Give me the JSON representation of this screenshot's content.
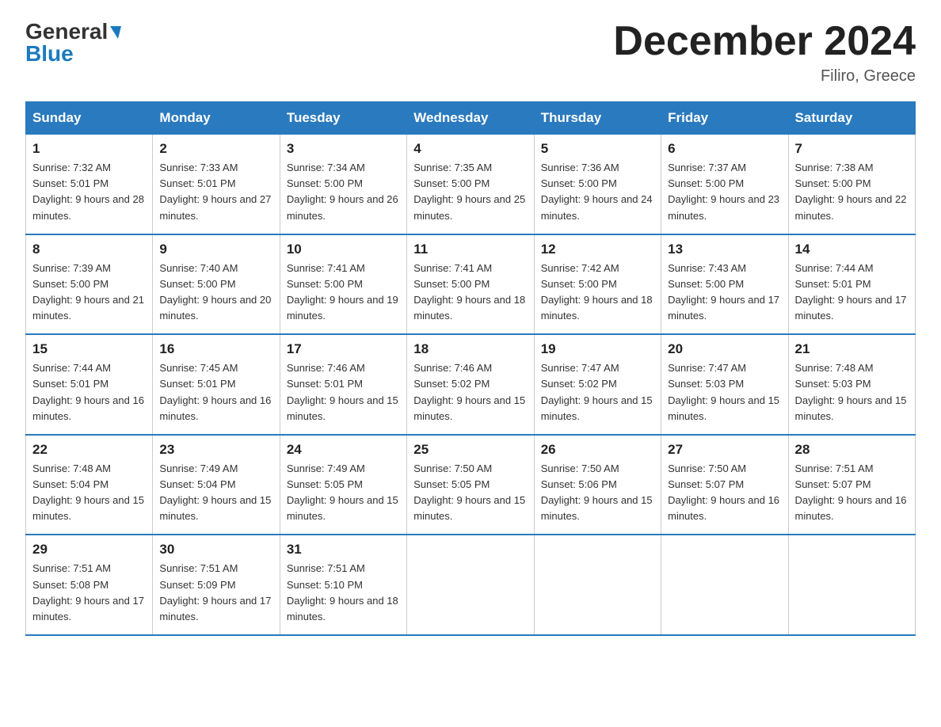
{
  "header": {
    "logo_general": "General",
    "logo_blue": "Blue",
    "title": "December 2024",
    "location": "Filiro, Greece"
  },
  "days_of_week": [
    "Sunday",
    "Monday",
    "Tuesday",
    "Wednesday",
    "Thursday",
    "Friday",
    "Saturday"
  ],
  "weeks": [
    [
      {
        "day": "1",
        "sunrise": "7:32 AM",
        "sunset": "5:01 PM",
        "daylight": "9 hours and 28 minutes."
      },
      {
        "day": "2",
        "sunrise": "7:33 AM",
        "sunset": "5:01 PM",
        "daylight": "9 hours and 27 minutes."
      },
      {
        "day": "3",
        "sunrise": "7:34 AM",
        "sunset": "5:00 PM",
        "daylight": "9 hours and 26 minutes."
      },
      {
        "day": "4",
        "sunrise": "7:35 AM",
        "sunset": "5:00 PM",
        "daylight": "9 hours and 25 minutes."
      },
      {
        "day": "5",
        "sunrise": "7:36 AM",
        "sunset": "5:00 PM",
        "daylight": "9 hours and 24 minutes."
      },
      {
        "day": "6",
        "sunrise": "7:37 AM",
        "sunset": "5:00 PM",
        "daylight": "9 hours and 23 minutes."
      },
      {
        "day": "7",
        "sunrise": "7:38 AM",
        "sunset": "5:00 PM",
        "daylight": "9 hours and 22 minutes."
      }
    ],
    [
      {
        "day": "8",
        "sunrise": "7:39 AM",
        "sunset": "5:00 PM",
        "daylight": "9 hours and 21 minutes."
      },
      {
        "day": "9",
        "sunrise": "7:40 AM",
        "sunset": "5:00 PM",
        "daylight": "9 hours and 20 minutes."
      },
      {
        "day": "10",
        "sunrise": "7:41 AM",
        "sunset": "5:00 PM",
        "daylight": "9 hours and 19 minutes."
      },
      {
        "day": "11",
        "sunrise": "7:41 AM",
        "sunset": "5:00 PM",
        "daylight": "9 hours and 18 minutes."
      },
      {
        "day": "12",
        "sunrise": "7:42 AM",
        "sunset": "5:00 PM",
        "daylight": "9 hours and 18 minutes."
      },
      {
        "day": "13",
        "sunrise": "7:43 AM",
        "sunset": "5:00 PM",
        "daylight": "9 hours and 17 minutes."
      },
      {
        "day": "14",
        "sunrise": "7:44 AM",
        "sunset": "5:01 PM",
        "daylight": "9 hours and 17 minutes."
      }
    ],
    [
      {
        "day": "15",
        "sunrise": "7:44 AM",
        "sunset": "5:01 PM",
        "daylight": "9 hours and 16 minutes."
      },
      {
        "day": "16",
        "sunrise": "7:45 AM",
        "sunset": "5:01 PM",
        "daylight": "9 hours and 16 minutes."
      },
      {
        "day": "17",
        "sunrise": "7:46 AM",
        "sunset": "5:01 PM",
        "daylight": "9 hours and 15 minutes."
      },
      {
        "day": "18",
        "sunrise": "7:46 AM",
        "sunset": "5:02 PM",
        "daylight": "9 hours and 15 minutes."
      },
      {
        "day": "19",
        "sunrise": "7:47 AM",
        "sunset": "5:02 PM",
        "daylight": "9 hours and 15 minutes."
      },
      {
        "day": "20",
        "sunrise": "7:47 AM",
        "sunset": "5:03 PM",
        "daylight": "9 hours and 15 minutes."
      },
      {
        "day": "21",
        "sunrise": "7:48 AM",
        "sunset": "5:03 PM",
        "daylight": "9 hours and 15 minutes."
      }
    ],
    [
      {
        "day": "22",
        "sunrise": "7:48 AM",
        "sunset": "5:04 PM",
        "daylight": "9 hours and 15 minutes."
      },
      {
        "day": "23",
        "sunrise": "7:49 AM",
        "sunset": "5:04 PM",
        "daylight": "9 hours and 15 minutes."
      },
      {
        "day": "24",
        "sunrise": "7:49 AM",
        "sunset": "5:05 PM",
        "daylight": "9 hours and 15 minutes."
      },
      {
        "day": "25",
        "sunrise": "7:50 AM",
        "sunset": "5:05 PM",
        "daylight": "9 hours and 15 minutes."
      },
      {
        "day": "26",
        "sunrise": "7:50 AM",
        "sunset": "5:06 PM",
        "daylight": "9 hours and 15 minutes."
      },
      {
        "day": "27",
        "sunrise": "7:50 AM",
        "sunset": "5:07 PM",
        "daylight": "9 hours and 16 minutes."
      },
      {
        "day": "28",
        "sunrise": "7:51 AM",
        "sunset": "5:07 PM",
        "daylight": "9 hours and 16 minutes."
      }
    ],
    [
      {
        "day": "29",
        "sunrise": "7:51 AM",
        "sunset": "5:08 PM",
        "daylight": "9 hours and 17 minutes."
      },
      {
        "day": "30",
        "sunrise": "7:51 AM",
        "sunset": "5:09 PM",
        "daylight": "9 hours and 17 minutes."
      },
      {
        "day": "31",
        "sunrise": "7:51 AM",
        "sunset": "5:10 PM",
        "daylight": "9 hours and 18 minutes."
      },
      null,
      null,
      null,
      null
    ]
  ]
}
